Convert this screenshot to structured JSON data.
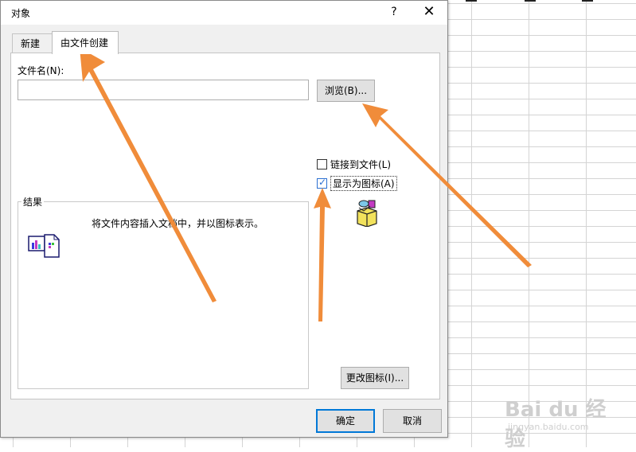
{
  "dialog": {
    "title": "对象",
    "help_label": "?",
    "close_label": "✕",
    "tabs": [
      {
        "label": "新建",
        "selected": false
      },
      {
        "label": "由文件创建",
        "selected": true
      }
    ],
    "filename_label": "文件名(N):",
    "filename_value": "",
    "browse_button": "浏览(B)...",
    "link_to_file": {
      "label": "链接到文件(L)",
      "checked": false
    },
    "display_as_icon": {
      "label": "显示为图标(A)",
      "checked": true
    },
    "result_legend": "结果",
    "result_text": "将文件内容插入文档中，并以图标表示。",
    "change_icon_button": "更改图标(I)...",
    "ok_button": "确定",
    "cancel_button": "取消"
  },
  "annotations": {
    "arrow_color": "#f08c3a",
    "count": 3
  },
  "watermark": {
    "brand": "Bai du 经验",
    "sub": "jingyan.baidu.com"
  },
  "colors": {
    "dialog_bg": "#f0f0f0",
    "panel_bg": "#ffffff",
    "ok_border": "#0078d7",
    "checkbox_accent": "#2b6fd1"
  }
}
